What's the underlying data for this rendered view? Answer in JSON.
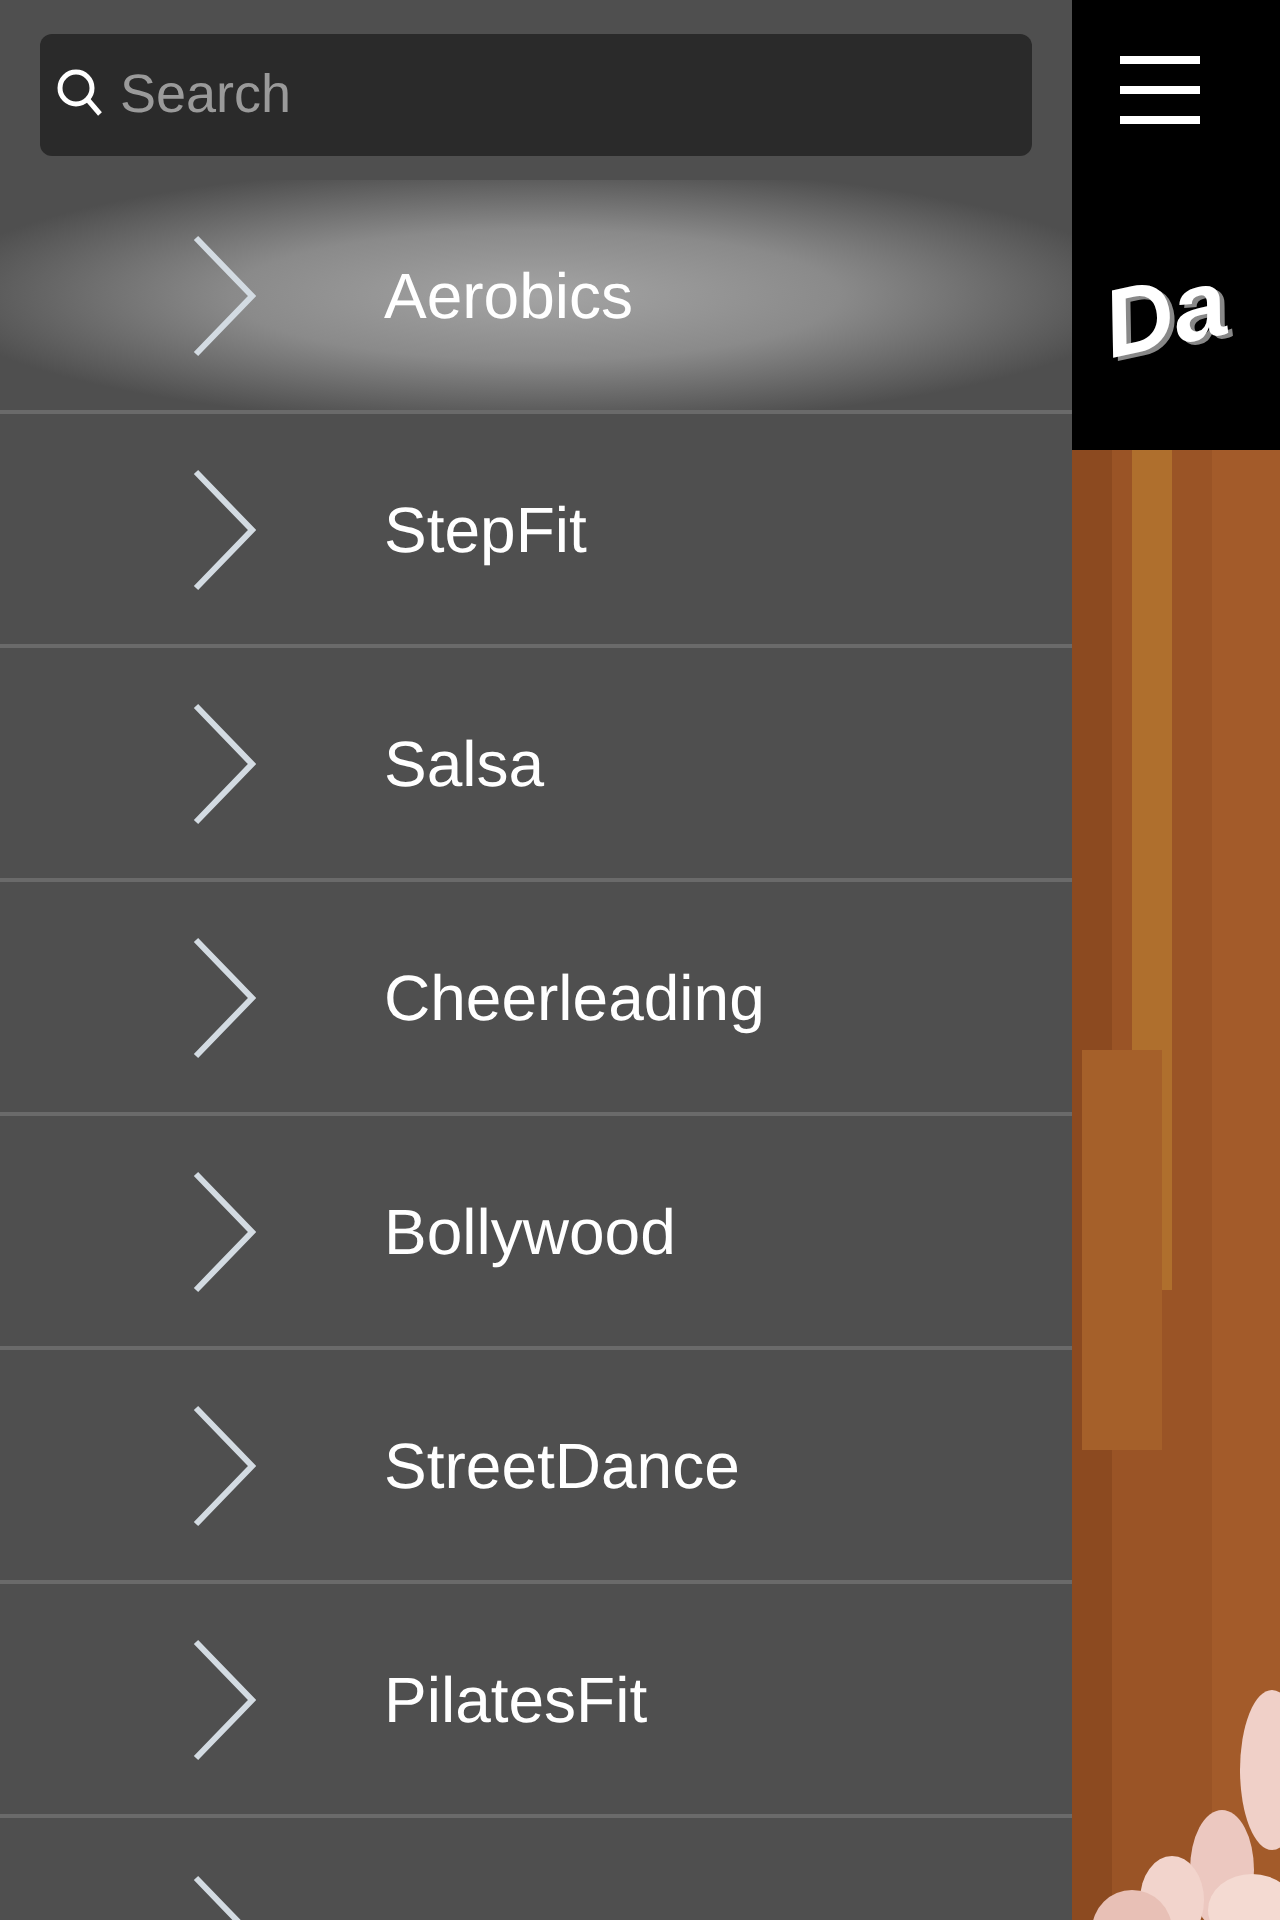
{
  "search": {
    "placeholder": "Search"
  },
  "menu": [
    {
      "label": "Aerobics",
      "selected": true
    },
    {
      "label": "StepFit",
      "selected": false
    },
    {
      "label": "Salsa",
      "selected": false
    },
    {
      "label": "Cheerleading",
      "selected": false
    },
    {
      "label": "Bollywood",
      "selected": false
    },
    {
      "label": "StreetDance",
      "selected": false
    },
    {
      "label": "PilatesFit",
      "selected": false
    }
  ],
  "menu_continues_below": true,
  "header": {
    "logo": "Da"
  }
}
